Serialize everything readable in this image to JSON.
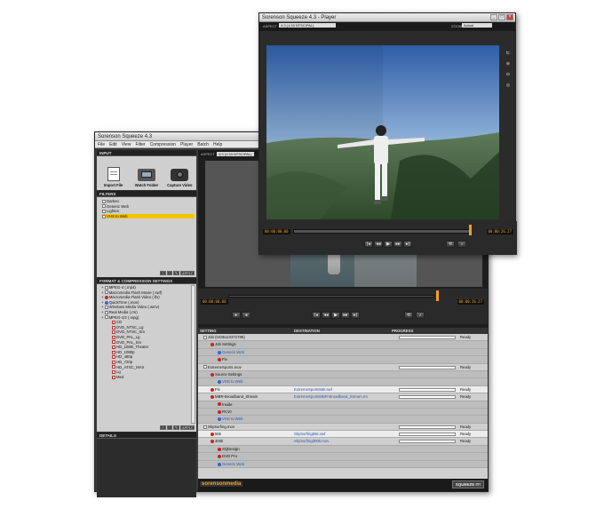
{
  "main_window": {
    "title": "Sorenson Squeeze 4.3",
    "menu": [
      "File",
      "Edit",
      "View",
      "Filter",
      "Compression",
      "Player",
      "Batch",
      "Help"
    ],
    "input_panel": {
      "header": "INPUT",
      "buttons": [
        "Import File",
        "Watch Folder",
        "Capture Video"
      ]
    },
    "filters_panel": {
      "header": "FILTERS",
      "items": [
        "Darken",
        "Generic Web",
        "Lighten",
        "VHS to Web"
      ],
      "selected_index": 3,
      "apply_label": "APPLY"
    },
    "format_panel": {
      "header": "FORMAT & COMPRESSION SETTINGS",
      "items": [
        {
          "label": "MPEG-4 (.mp4)",
          "indent": 0,
          "icon": "sq"
        },
        {
          "label": "Macromedia Flash Movie (.swf)",
          "indent": 0,
          "icon": "sq"
        },
        {
          "label": "Macromedia Flash Video (.flv)",
          "indent": 0,
          "icon": "red"
        },
        {
          "label": "QuickTime (.mov)",
          "indent": 0,
          "icon": "blue"
        },
        {
          "label": "Windows Media Video (.wmv)",
          "indent": 0,
          "icon": "sq"
        },
        {
          "label": "Real Media (.rm)",
          "indent": 0,
          "icon": "sq"
        },
        {
          "label": "MPEG-1/2 (.mpg)",
          "indent": 0,
          "icon": "sq"
        },
        {
          "label": "CD",
          "indent": 1,
          "icon": "doc"
        },
        {
          "label": "DVD_NTSC_Lg",
          "indent": 1,
          "icon": "doc"
        },
        {
          "label": "DVD_NTSC_Sm",
          "indent": 1,
          "icon": "doc"
        },
        {
          "label": "DVD_PAL_Lg",
          "indent": 1,
          "icon": "doc"
        },
        {
          "label": "DVD_PAL_Sm",
          "indent": 1,
          "icon": "doc"
        },
        {
          "label": "HD_1080i_Theater",
          "indent": 1,
          "icon": "doc"
        },
        {
          "label": "HD_1080p",
          "indent": 1,
          "icon": "doc"
        },
        {
          "label": "HD_480p",
          "indent": 1,
          "icon": "doc"
        },
        {
          "label": "HD_720p",
          "indent": 1,
          "icon": "doc"
        },
        {
          "label": "HD_ATSC_MAX",
          "indent": 1,
          "icon": "doc"
        },
        {
          "label": "Lg",
          "indent": 1,
          "icon": "doc"
        },
        {
          "label": "Med",
          "indent": 1,
          "icon": "doc"
        }
      ],
      "apply_label": "APPLY"
    },
    "details_panel": {
      "header": "DETAILS"
    },
    "aspect_label": "ASPECT",
    "aspect_value": "4:3 (1:33 NTSC/PAL)",
    "timecode_in": "00:00:00.00",
    "timecode_out": "00:00:26.27",
    "job_table": {
      "headers": [
        "SETTING",
        "DESTINATION",
        "PROGRESS"
      ],
      "rows": [
        {
          "setting": "Job (0435110372786)",
          "dest": "",
          "prog": "Ready",
          "indent": 0,
          "style": "plain"
        },
        {
          "setting": "Job Settings",
          "dest": "",
          "prog": "",
          "indent": 1,
          "style": "alt"
        },
        {
          "setting": "Generic Web",
          "dest": "",
          "prog": "",
          "indent": 2,
          "style": "alt",
          "link": true
        },
        {
          "setting": "Flv",
          "dest": "",
          "prog": "",
          "indent": 2,
          "style": "alt"
        },
        {
          "setting": "ExtremeSports.mov",
          "dest": "",
          "prog": "Ready",
          "indent": 0,
          "style": "plain"
        },
        {
          "setting": "Source Settings",
          "dest": "",
          "prog": "",
          "indent": 1,
          "style": "alt"
        },
        {
          "setting": "VHS to Web",
          "dest": "",
          "prog": "",
          "indent": 2,
          "style": "alt",
          "link": true
        },
        {
          "setting": "Flv",
          "dest": "ExtremeSports56k.swf",
          "prog": "Ready",
          "indent": 1,
          "style": "sel"
        },
        {
          "setting": "MBR-Broadband_Stream",
          "dest": "ExtremeSportsMBR-Broadband_Stream.rm",
          "prog": "Ready",
          "indent": 1,
          "style": "plain"
        },
        {
          "setting": "Inside",
          "dest": "",
          "prog": "",
          "indent": 2,
          "style": "alt"
        },
        {
          "setting": "RV10",
          "dest": "",
          "prog": "",
          "indent": 2,
          "style": "alt"
        },
        {
          "setting": "VHS to Web",
          "dest": "",
          "prog": "",
          "indent": 2,
          "style": "alt",
          "link": true
        },
        {
          "setting": "SkySurfing.mov",
          "dest": "",
          "prog": "Ready",
          "indent": 0,
          "style": "plain"
        },
        {
          "setting": "56k",
          "dest": "SkySurfing56k.swf",
          "prog": "Ready",
          "indent": 1,
          "style": "sel"
        },
        {
          "setting": "300k",
          "dest": "SkySurfing300k.mov",
          "prog": "Ready",
          "indent": 1,
          "style": "plain"
        },
        {
          "setting": "SQDesign",
          "dest": "",
          "prog": "",
          "indent": 2,
          "style": "alt"
        },
        {
          "setting": "DVD Pro",
          "dest": "",
          "prog": "",
          "indent": 2,
          "style": "alt"
        },
        {
          "setting": "Generic Web",
          "dest": "",
          "prog": "",
          "indent": 2,
          "style": "alt",
          "link": true
        }
      ]
    },
    "logo_text": "sorensonmedia",
    "squeeze_button": "SQUEEZE IT!"
  },
  "player_window": {
    "title": "Sorenson Squeeze 4.3 - Player",
    "aspect_label": "ASPECT",
    "aspect_value": "4:3 (1:33 NTSC/PAL)",
    "zoom_label": "ZOOM",
    "zoom_value": "Actual",
    "timecode_in": "00:00:00.00",
    "timecode_out": "00:00:26.27",
    "side_tools": [
      "tc",
      "zoom-in-icon",
      "zoom-out-icon",
      "reset-icon"
    ]
  },
  "colors": {
    "accent": "#f5c400",
    "timecode": "#f0a020",
    "panel_dark": "#222222",
    "panel_grey": "#cfcfcf"
  }
}
